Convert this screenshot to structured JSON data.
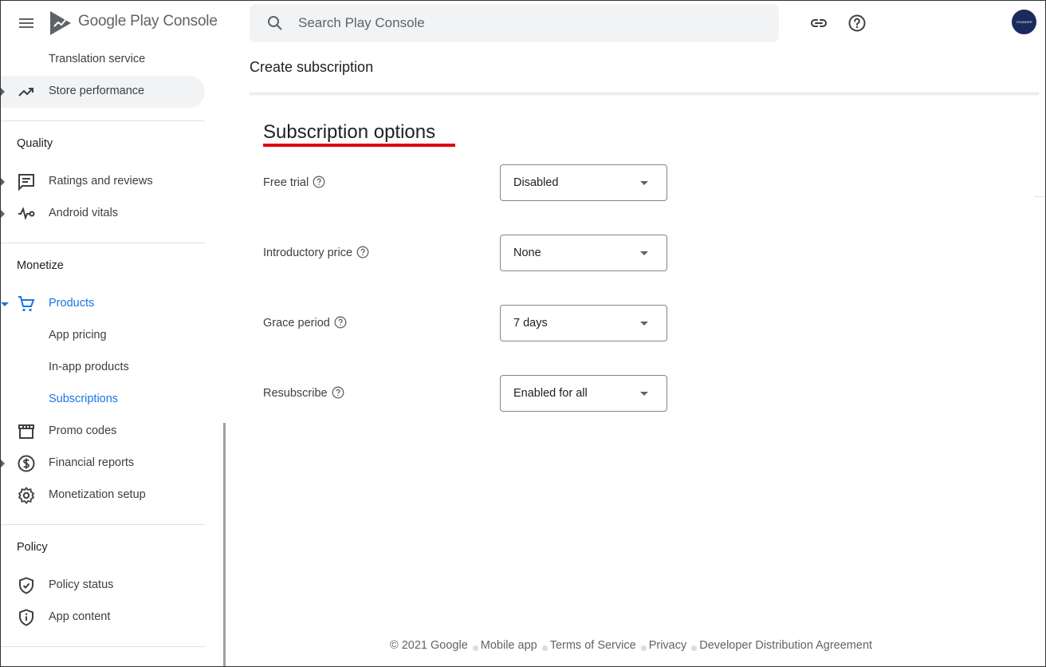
{
  "header": {
    "logo_text": "Google Play Console",
    "search_placeholder": "Search Play Console",
    "avatar_text": "YOUNGER"
  },
  "sidebar": {
    "items_top": [
      {
        "label": "Translation service",
        "icon": "none"
      },
      {
        "label": "Store performance",
        "icon": "trending-up-icon"
      }
    ],
    "quality": {
      "title": "Quality",
      "items": [
        {
          "label": "Ratings and reviews",
          "icon": "reviews-icon"
        },
        {
          "label": "Android vitals",
          "icon": "vitals-icon"
        }
      ]
    },
    "monetize": {
      "title": "Monetize",
      "items": [
        {
          "label": "Products",
          "icon": "cart-icon"
        },
        {
          "label": "App pricing"
        },
        {
          "label": "In-app products"
        },
        {
          "label": "Subscriptions"
        },
        {
          "label": "Promo codes",
          "icon": "store-icon"
        },
        {
          "label": "Financial reports",
          "icon": "dollar-icon"
        },
        {
          "label": "Monetization setup",
          "icon": "gear-icon"
        }
      ]
    },
    "policy": {
      "title": "Policy",
      "items": [
        {
          "label": "Policy status",
          "icon": "shield-check-icon"
        },
        {
          "label": "App content",
          "icon": "shield-info-icon"
        }
      ]
    }
  },
  "main": {
    "page_title": "Create subscription",
    "section_heading": "Subscription options",
    "options": [
      {
        "label": "Free trial",
        "value": "Disabled"
      },
      {
        "label": "Introductory price",
        "value": "None"
      },
      {
        "label": "Grace period",
        "value": "7 days"
      },
      {
        "label": "Resubscribe",
        "value": "Enabled for all"
      }
    ]
  },
  "footer": {
    "copyright": "© 2021 Google",
    "links": [
      "Mobile app",
      "Terms of Service",
      "Privacy",
      "Developer Distribution Agreement"
    ]
  },
  "colors": {
    "accent": "#1a73e8",
    "underline": "#e0000f",
    "avatar_bg": "#1a2a5e"
  }
}
